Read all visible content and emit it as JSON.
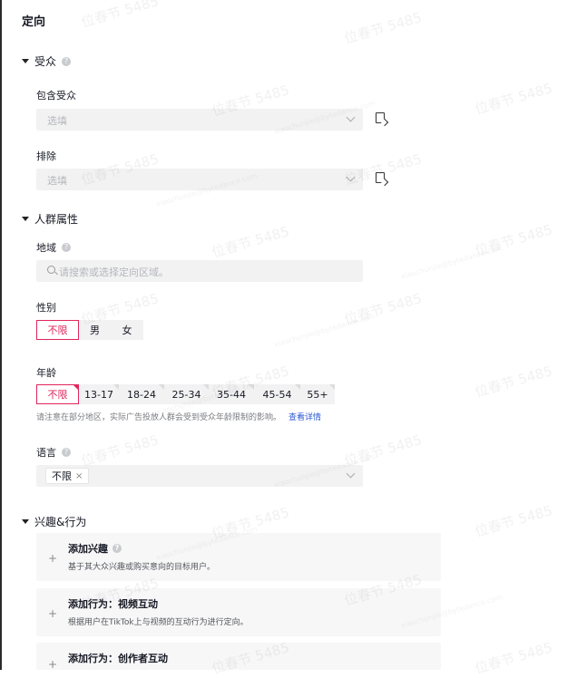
{
  "title": "定向",
  "audience": {
    "heading": "受众",
    "include_label": "包含受众",
    "include_placeholder": "选填",
    "exclude_label": "排除",
    "exclude_placeholder": "选填"
  },
  "demographics": {
    "heading": "人群属性",
    "region_label": "地域",
    "region_placeholder": "请搜索或选择定向区域。",
    "gender_label": "性别",
    "gender_options": [
      "不限",
      "男",
      "女"
    ],
    "gender_selected": "不限",
    "age_label": "年龄",
    "age_options": [
      "不限",
      "13-17",
      "18-24",
      "25-34",
      "35-44",
      "45-54",
      "55+"
    ],
    "age_selected": "不限",
    "age_hint": "请注意在部分地区，实际广告投放人群会受到受众年龄限制的影响。",
    "age_hint_link": "查看详情",
    "language_label": "语言",
    "language_tag": "不限"
  },
  "interests": {
    "heading": "兴趣&行为",
    "cards": [
      {
        "title": "添加兴趣",
        "desc": "基于其大众兴趣或购买意向的目标用户。",
        "has_help": true
      },
      {
        "title": "添加行为：视频互动",
        "desc": "根据用户在TikTok上与视频的互动行为进行定向。",
        "has_help": false
      },
      {
        "title": "添加行为：创作者互动",
        "desc": "",
        "has_help": false
      }
    ]
  },
  "watermark": {
    "name": "位春节 5485",
    "small": "xiaochunjie@bytedance.com"
  }
}
